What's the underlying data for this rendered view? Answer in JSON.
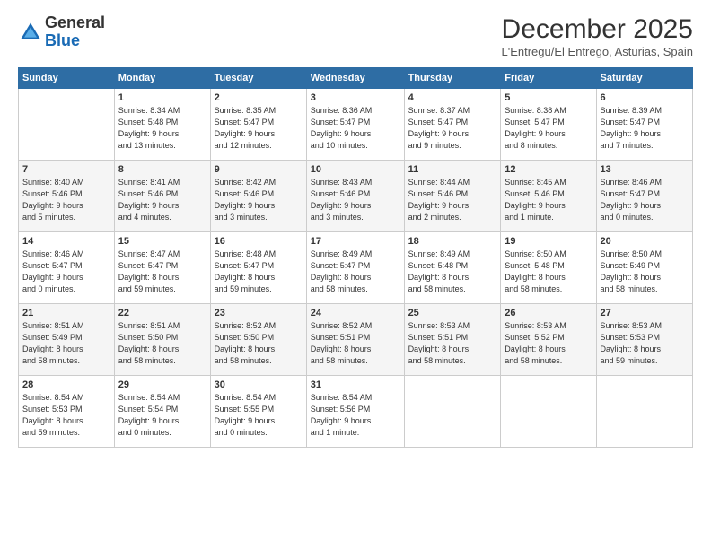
{
  "logo": {
    "general": "General",
    "blue": "Blue"
  },
  "header": {
    "month": "December 2025",
    "location": "L'Entregu/El Entrego, Asturias, Spain"
  },
  "weekdays": [
    "Sunday",
    "Monday",
    "Tuesday",
    "Wednesday",
    "Thursday",
    "Friday",
    "Saturday"
  ],
  "weeks": [
    [
      {
        "day": "",
        "detail": ""
      },
      {
        "day": "1",
        "detail": "Sunrise: 8:34 AM\nSunset: 5:48 PM\nDaylight: 9 hours\nand 13 minutes."
      },
      {
        "day": "2",
        "detail": "Sunrise: 8:35 AM\nSunset: 5:47 PM\nDaylight: 9 hours\nand 12 minutes."
      },
      {
        "day": "3",
        "detail": "Sunrise: 8:36 AM\nSunset: 5:47 PM\nDaylight: 9 hours\nand 10 minutes."
      },
      {
        "day": "4",
        "detail": "Sunrise: 8:37 AM\nSunset: 5:47 PM\nDaylight: 9 hours\nand 9 minutes."
      },
      {
        "day": "5",
        "detail": "Sunrise: 8:38 AM\nSunset: 5:47 PM\nDaylight: 9 hours\nand 8 minutes."
      },
      {
        "day": "6",
        "detail": "Sunrise: 8:39 AM\nSunset: 5:47 PM\nDaylight: 9 hours\nand 7 minutes."
      }
    ],
    [
      {
        "day": "7",
        "detail": "Sunrise: 8:40 AM\nSunset: 5:46 PM\nDaylight: 9 hours\nand 5 minutes."
      },
      {
        "day": "8",
        "detail": "Sunrise: 8:41 AM\nSunset: 5:46 PM\nDaylight: 9 hours\nand 4 minutes."
      },
      {
        "day": "9",
        "detail": "Sunrise: 8:42 AM\nSunset: 5:46 PM\nDaylight: 9 hours\nand 3 minutes."
      },
      {
        "day": "10",
        "detail": "Sunrise: 8:43 AM\nSunset: 5:46 PM\nDaylight: 9 hours\nand 3 minutes."
      },
      {
        "day": "11",
        "detail": "Sunrise: 8:44 AM\nSunset: 5:46 PM\nDaylight: 9 hours\nand 2 minutes."
      },
      {
        "day": "12",
        "detail": "Sunrise: 8:45 AM\nSunset: 5:46 PM\nDaylight: 9 hours\nand 1 minute."
      },
      {
        "day": "13",
        "detail": "Sunrise: 8:46 AM\nSunset: 5:47 PM\nDaylight: 9 hours\nand 0 minutes."
      }
    ],
    [
      {
        "day": "14",
        "detail": "Sunrise: 8:46 AM\nSunset: 5:47 PM\nDaylight: 9 hours\nand 0 minutes."
      },
      {
        "day": "15",
        "detail": "Sunrise: 8:47 AM\nSunset: 5:47 PM\nDaylight: 8 hours\nand 59 minutes."
      },
      {
        "day": "16",
        "detail": "Sunrise: 8:48 AM\nSunset: 5:47 PM\nDaylight: 8 hours\nand 59 minutes."
      },
      {
        "day": "17",
        "detail": "Sunrise: 8:49 AM\nSunset: 5:47 PM\nDaylight: 8 hours\nand 58 minutes."
      },
      {
        "day": "18",
        "detail": "Sunrise: 8:49 AM\nSunset: 5:48 PM\nDaylight: 8 hours\nand 58 minutes."
      },
      {
        "day": "19",
        "detail": "Sunrise: 8:50 AM\nSunset: 5:48 PM\nDaylight: 8 hours\nand 58 minutes."
      },
      {
        "day": "20",
        "detail": "Sunrise: 8:50 AM\nSunset: 5:49 PM\nDaylight: 8 hours\nand 58 minutes."
      }
    ],
    [
      {
        "day": "21",
        "detail": "Sunrise: 8:51 AM\nSunset: 5:49 PM\nDaylight: 8 hours\nand 58 minutes."
      },
      {
        "day": "22",
        "detail": "Sunrise: 8:51 AM\nSunset: 5:50 PM\nDaylight: 8 hours\nand 58 minutes."
      },
      {
        "day": "23",
        "detail": "Sunrise: 8:52 AM\nSunset: 5:50 PM\nDaylight: 8 hours\nand 58 minutes."
      },
      {
        "day": "24",
        "detail": "Sunrise: 8:52 AM\nSunset: 5:51 PM\nDaylight: 8 hours\nand 58 minutes."
      },
      {
        "day": "25",
        "detail": "Sunrise: 8:53 AM\nSunset: 5:51 PM\nDaylight: 8 hours\nand 58 minutes."
      },
      {
        "day": "26",
        "detail": "Sunrise: 8:53 AM\nSunset: 5:52 PM\nDaylight: 8 hours\nand 58 minutes."
      },
      {
        "day": "27",
        "detail": "Sunrise: 8:53 AM\nSunset: 5:53 PM\nDaylight: 8 hours\nand 59 minutes."
      }
    ],
    [
      {
        "day": "28",
        "detail": "Sunrise: 8:54 AM\nSunset: 5:53 PM\nDaylight: 8 hours\nand 59 minutes."
      },
      {
        "day": "29",
        "detail": "Sunrise: 8:54 AM\nSunset: 5:54 PM\nDaylight: 9 hours\nand 0 minutes."
      },
      {
        "day": "30",
        "detail": "Sunrise: 8:54 AM\nSunset: 5:55 PM\nDaylight: 9 hours\nand 0 minutes."
      },
      {
        "day": "31",
        "detail": "Sunrise: 8:54 AM\nSunset: 5:56 PM\nDaylight: 9 hours\nand 1 minute."
      },
      {
        "day": "",
        "detail": ""
      },
      {
        "day": "",
        "detail": ""
      },
      {
        "day": "",
        "detail": ""
      }
    ]
  ]
}
